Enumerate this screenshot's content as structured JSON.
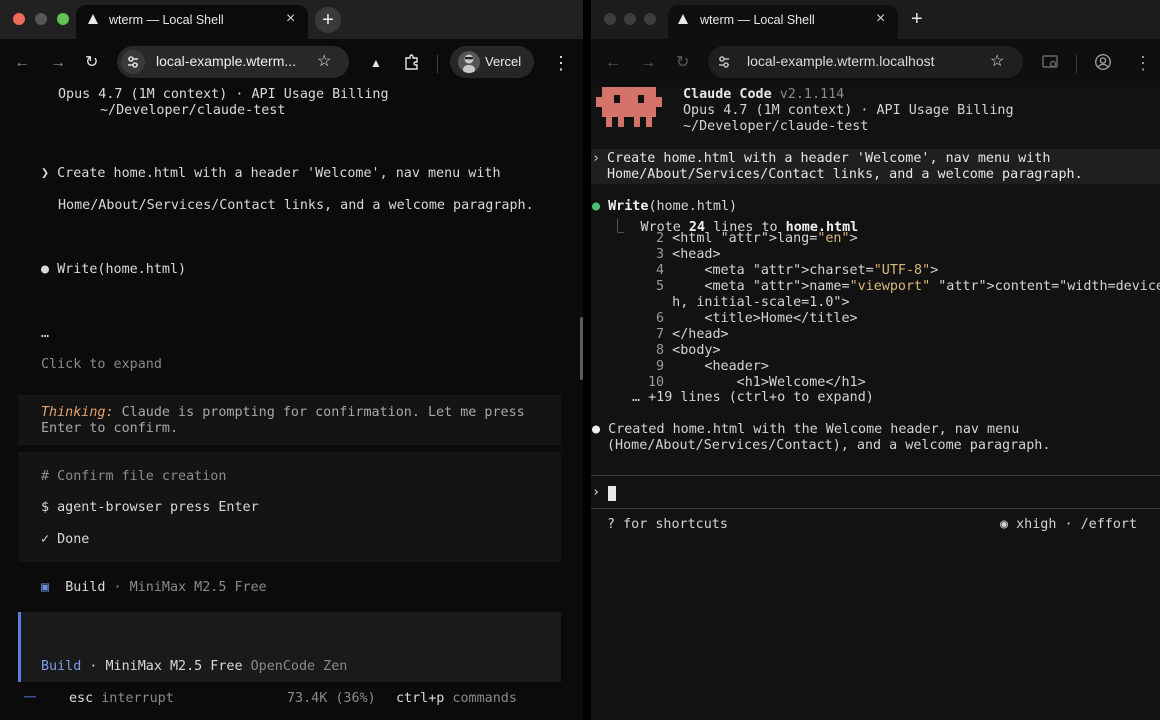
{
  "left_browser": {
    "tab_title": "wterm — Local Shell",
    "url": "local-example.wterm...",
    "profile_label": "Vercel"
  },
  "right_browser": {
    "tab_title": "wterm — Local Shell",
    "url": "local-example.wterm.localhost"
  },
  "left_terminal": {
    "header_model": "Opus 4.7 (1M context) · API Usage Billing",
    "header_path": "~/Developer/claude-test",
    "prompt_line1": "❯ Create home.html with a header 'Welcome', nav menu with",
    "prompt_line2": "Home/About/Services/Contact links, and a welcome paragraph.",
    "tool_call": "● Write(home.html)",
    "ellipsis": "…",
    "expand_hint": "Click to expand",
    "thinking_label": "Thinking:",
    "thinking_text1": " Claude is prompting for confirmation. Let me press",
    "thinking_text2": "Enter to confirm.",
    "comment": "# Confirm file creation",
    "command": "$ agent-browser press Enter",
    "done": "✓ Done",
    "build_label": "Build",
    "build_model": " · MiniMax M2.5 Free",
    "footer_build_label": "Build",
    "footer_model": " · MiniMax M2.5 Free",
    "footer_provider": " OpenCode Zen",
    "status_dots": "⋯⋯",
    "status_esc": "esc",
    "status_interrupt": " interrupt",
    "status_tokens": "73.4K (36%)",
    "status_ctrlp": "ctrl+p",
    "status_commands": " commands"
  },
  "right_terminal": {
    "app_name": "Claude Code",
    "app_version": " v2.1.114",
    "model": "Opus 4.7 (1M context) · API Usage Billing",
    "path": "~/Developer/claude-test",
    "prompt_line1": "Create home.html with a header 'Welcome', nav menu with",
    "prompt_line2": "Home/About/Services/Contact links, and a welcome paragraph.",
    "tool_name": "Write",
    "tool_arg": "(home.html)",
    "wrote_prefix": "Wrote ",
    "wrote_count": "24",
    "wrote_mid": " lines to ",
    "wrote_file": "home.html",
    "code_lines": [
      {
        "n": " 2",
        "t": "<html lang=\"en\">"
      },
      {
        "n": " 3",
        "t": "<head>"
      },
      {
        "n": " 4",
        "t": "    <meta charset=\"UTF-8\">"
      },
      {
        "n": " 5",
        "t": "    <meta name=\"viewport\" content=\"width=device-widt"
      },
      {
        "n": "  ",
        "t": "h, initial-scale=1.0\">"
      },
      {
        "n": " 6",
        "t": "    <title>Home</title>"
      },
      {
        "n": " 7",
        "t": "</head>"
      },
      {
        "n": " 8",
        "t": "<body>"
      },
      {
        "n": " 9",
        "t": "    <header>"
      },
      {
        "n": "10",
        "t": "        <h1>Welcome</h1>"
      }
    ],
    "more_lines": "… +19 lines (ctrl+o to expand)",
    "result_line1": "Created home.html with the Welcome header, nav menu",
    "result_line2": "(Home/About/Services/Contact), and a welcome paragraph.",
    "shortcuts_hint": "? for shortcuts",
    "effort": "◉ xhigh · /effort"
  }
}
